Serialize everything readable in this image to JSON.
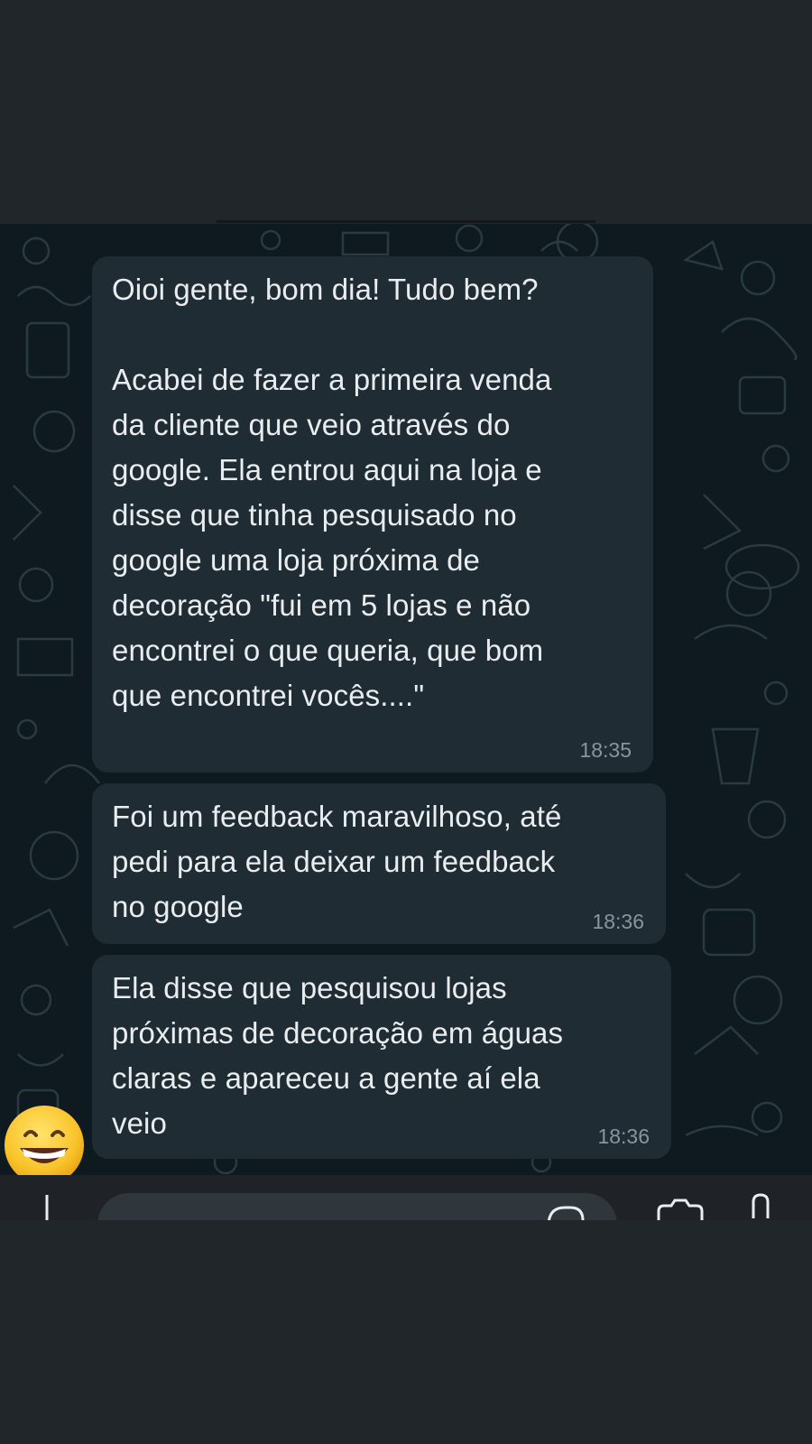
{
  "messages": [
    {
      "text": "Oioi gente, bom dia! Tudo bem?\n\nAcabei de fazer a primeira venda\nda cliente que veio através do\ngoogle. Ela entrou aqui na loja e\ndisse que tinha pesquisado no\ngoogle uma loja próxima de\ndecoração \"fui em 5 lojas e não\nencontrei o que queria, que bom\nque encontrei vocês....\"",
      "time": "18:35"
    },
    {
      "text": "Foi um feedback maravilhoso, até\npedi para ela deixar um feedback\nno google",
      "time": "18:36"
    },
    {
      "text": "Ela disse que pesquisou lojas\npróximas de decoração em águas\nclaras e apareceu a gente aí ela\nveio",
      "time": "18:36"
    }
  ],
  "reaction": {
    "emoji_icon": "grinning-face-icon"
  },
  "colors": {
    "chat_background": "#0e1a1f",
    "bubble": "#202c33",
    "message_text": "#e9edef",
    "timestamp": "#8696a0",
    "redaction_highlight": "#ffee00",
    "toolbar": "#1f2327",
    "frame": "#21262a"
  },
  "input_bar": {
    "icons": [
      "plus-icon",
      "sticker-icon",
      "camera-icon",
      "microphone-icon"
    ]
  }
}
